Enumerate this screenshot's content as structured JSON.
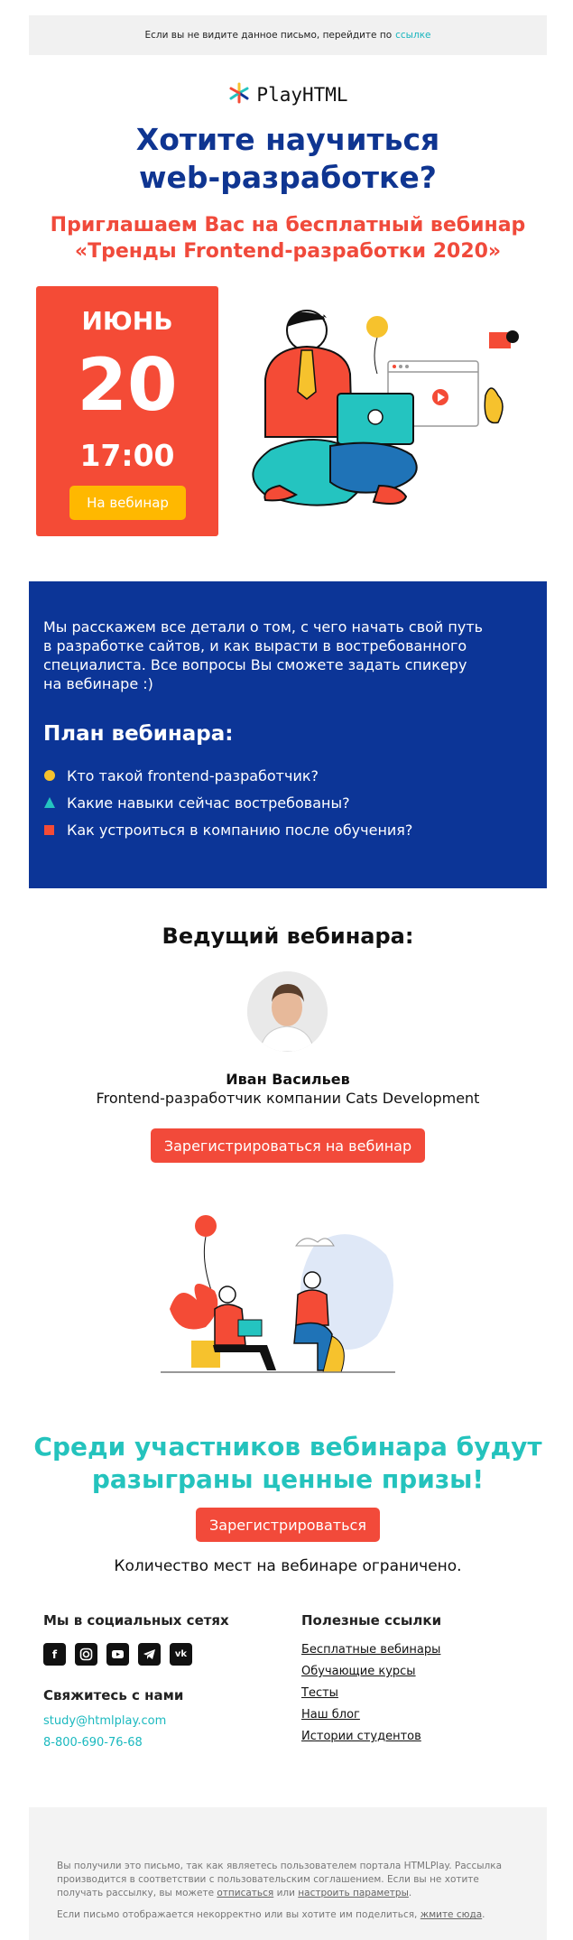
{
  "preheader": {
    "text": "Если вы не видите данное письмо, перейдите по",
    "link": "ссылке"
  },
  "logo": {
    "text": "PlayHTML",
    "icon": "burst-icon"
  },
  "hero": {
    "title_line1": "Хотите научиться",
    "title_line2": "web-разработке?",
    "subtitle_line1": "Приглашаем Вас на бесплатный вебинар",
    "subtitle_line2": "«Тренды Frontend-разработки 2020»"
  },
  "date_card": {
    "month": "ИЮНЬ",
    "day": "20",
    "time": "17:00",
    "button": "На вебинар"
  },
  "info": {
    "intro_l1": "Мы расскажем все детали о том, с чего начать свой путь",
    "intro_l2": "в разработке сайтов, и как вырасти в востребованного",
    "intro_l3": "специалиста. Все вопросы Вы сможете задать спикеру",
    "intro_l4": "на вебинаре :)",
    "plan_title": "План вебинара:",
    "plan": [
      "Кто такой frontend-разработчик?",
      "Какие навыки сейчас востребованы?",
      "Как устроиться в компанию после обучения?"
    ]
  },
  "speaker": {
    "section_title": "Ведущий вебинара:",
    "name": "Иван Васильев",
    "role": "Frontend-разработчик компании Cats Development",
    "button": "Зарегистрироваться на вебинар"
  },
  "prizes": {
    "line1": "Среди участников вебинара будут",
    "line2": "разыграны ценные призы!",
    "button": "Зарегистрироваться",
    "note": "Количество мест на вебинаре ограничено."
  },
  "footer": {
    "social_title": "Мы в социальных сетях",
    "social": [
      "facebook-icon",
      "instagram-icon",
      "youtube-icon",
      "telegram-icon",
      "vk-icon"
    ],
    "contact_title": "Свяжитесь с нами",
    "email": "study@htmlplay.com",
    "phone": "8-800-690-76-68",
    "links_title": "Полезные ссылки",
    "links": [
      "Бесплатные вебинары",
      "Обучающие курсы",
      "Тесты",
      "Наш блог",
      "Истории студентов"
    ]
  },
  "legal": {
    "p1_a": "Вы получили это письмо, так как являетесь пользователем портала HTMLPlay. Рассылка производится в соответствии с пользовательским соглашением. Если вы не хотите получать рассылку, вы можете",
    "unsubscribe": "отписаться",
    "or": "или",
    "settings": "настроить параметры",
    "p2_a": "Если письмо отображается некорректно или вы хотите им поделиться,",
    "click_here": "жмите сюда"
  },
  "colors": {
    "blue": "#0c3597",
    "red": "#f44b36",
    "teal": "#24c3bd",
    "yellow": "#ffb800"
  }
}
